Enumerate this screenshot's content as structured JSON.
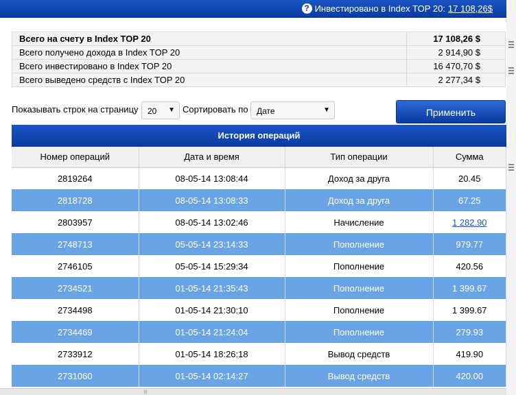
{
  "topbar": {
    "invest_label": "Инвестировано в Index TOP 20:",
    "invest_amount": "17 108,26$"
  },
  "summary": [
    {
      "label": "Всего на счету в Index TOP 20",
      "value": "17 108,26 $"
    },
    {
      "label": "Всего получено дохода в Index TOP 20",
      "value": "2 914,90 $"
    },
    {
      "label": "Всего инвестировано в Index TOP 20",
      "value": "16 470,70 $"
    },
    {
      "label": "Всего выведено средств с Index TOP 20",
      "value": "2 277,34 $"
    }
  ],
  "controls": {
    "rows_label": "Показывать строк на страницу",
    "rows_value": "20",
    "sort_label": "Сортировать по",
    "sort_value": "Дате",
    "apply_label": "Применить"
  },
  "history": {
    "title": "История операций",
    "columns": [
      "Номер операций",
      "Дата и время",
      "Тип операции",
      "Сумма"
    ],
    "rows": [
      {
        "id": "2819264",
        "datetime": "08-05-14 13:08:44",
        "type": "Доход за друга",
        "amount": "20.45"
      },
      {
        "id": "2818728",
        "datetime": "08-05-14 13:08:33",
        "type": "Доход за друга",
        "amount": "67.25"
      },
      {
        "id": "2803957",
        "datetime": "08-05-14 13:02:46",
        "type": "Начисление",
        "amount": "1 282.90"
      },
      {
        "id": "2748713",
        "datetime": "05-05-14 23:14:33",
        "type": "Пополнение",
        "amount": "979.77"
      },
      {
        "id": "2746105",
        "datetime": "05-05-14 15:29:34",
        "type": "Пополнение",
        "amount": "420.56"
      },
      {
        "id": "2734521",
        "datetime": "01-05-14 21:35:43",
        "type": "Пополнение",
        "amount": "1 399.67"
      },
      {
        "id": "2734498",
        "datetime": "01-05-14 21:30:10",
        "type": "Пополнение",
        "amount": "1 399.67"
      },
      {
        "id": "2734469",
        "datetime": "01-05-14 21:24:04",
        "type": "Пополнение",
        "amount": "279.93"
      },
      {
        "id": "2733912",
        "datetime": "01-05-14 18:26:18",
        "type": "Вывод средств",
        "amount": "419.90"
      },
      {
        "id": "2731060",
        "datetime": "01-05-14 02:14:27",
        "type": "Вывод средств",
        "amount": "420.00"
      }
    ]
  }
}
